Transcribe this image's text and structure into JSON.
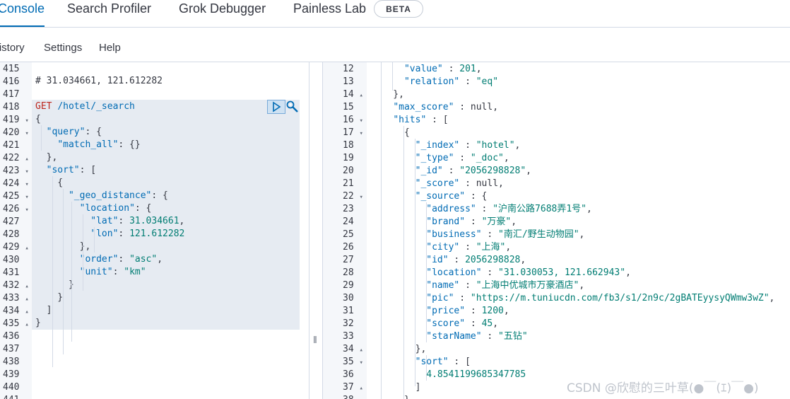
{
  "tabs": {
    "console": "Console",
    "search_profiler": "Search Profiler",
    "grok_debugger": "Grok Debugger",
    "painless_lab": "Painless Lab",
    "beta": "BETA"
  },
  "menu": {
    "history": "History",
    "settings": "Settings",
    "help": "Help"
  },
  "request": {
    "first_line": 415,
    "comment": "# 31.034661, 121.612282",
    "method": "GET",
    "path": "/hotel/_search",
    "body": [
      "{",
      "  \"query\": {",
      "    \"match_all\": {}",
      "  },",
      "  \"sort\": [",
      "    {",
      "      \"_geo_distance\": {",
      "        \"location\": {",
      "          \"lat\": 31.034661,",
      "          \"lon\": 121.612282",
      "        },",
      "        \"order\": \"asc\",",
      "        \"unit\": \"km\"",
      "      }",
      "    }",
      "  ]",
      "}"
    ]
  },
  "response": {
    "first_line": 12,
    "lines": [
      "      \"value\" : 201,",
      "      \"relation\" : \"eq\"",
      "    },",
      "    \"max_score\" : null,",
      "    \"hits\" : [",
      "      {",
      "        \"_index\" : \"hotel\",",
      "        \"_type\" : \"_doc\",",
      "        \"_id\" : \"2056298828\",",
      "        \"_score\" : null,",
      "        \"_source\" : {",
      "          \"address\" : \"沪南公路7688弄1号\",",
      "          \"brand\" : \"万豪\",",
      "          \"business\" : \"南汇/野生动物园\",",
      "          \"city\" : \"上海\",",
      "          \"id\" : 2056298828,",
      "          \"location\" : \"31.030053, 121.662943\",",
      "          \"name\" : \"上海中优城市万豪酒店\",",
      "          \"pic\" : \"https://m.tuniucdn.com/fb3/s1/2n9c/2gBATEyysyQWmw3wZ\",",
      "          \"price\" : 1200,",
      "          \"score\" : 45,",
      "          \"starName\" : \"五钻\"",
      "        },",
      "        \"sort\" : [",
      "          4.8541199685347785",
      "        ]",
      "      }"
    ]
  },
  "watermark": "CSDN @欣慰的三叶草(●￣(ｴ)￣●)"
}
